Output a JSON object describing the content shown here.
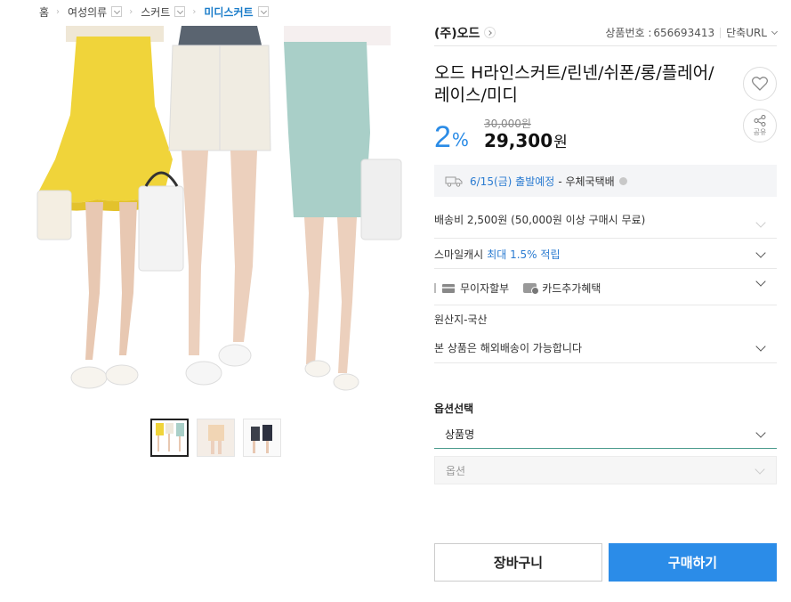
{
  "breadcrumb": {
    "items": [
      {
        "label": "홈"
      },
      {
        "label": "여성의류"
      },
      {
        "label": "스커트"
      },
      {
        "label": "미디스커트"
      }
    ]
  },
  "seller": {
    "name": "(주)오드",
    "product_no_label": "상품번호 :",
    "product_no": "656693413",
    "short_url_label": "단축URL"
  },
  "product": {
    "title": "오드 H라인스커트/린넨/쉬폰/롱/플레어/레이스/미디",
    "discount": "2",
    "discount_unit": "%",
    "original_price": "30,000원",
    "sale_price": "29,300",
    "sale_price_unit": "원"
  },
  "actions": {
    "share_label": "공유"
  },
  "shipping": {
    "date_text": "6/15(금) 출발예정",
    "method_text": "- 우체국택배",
    "fee_text": "배송비 2,500원 (50,000원 이상 구매시 무료)"
  },
  "smile_cash": {
    "label": "스마일캐시",
    "highlight": "최대 1.5% 적립"
  },
  "benefits": {
    "items": [
      {
        "label": "무이자할부",
        "icon": "card-icon"
      },
      {
        "label": "카드추가혜택",
        "icon": "card-benefit-icon"
      }
    ]
  },
  "origin_text": "원산지-국산",
  "overseas_text": "본 상품은 해외배송이 가능합니다",
  "options": {
    "title": "옵션선택",
    "product_select": "상품명",
    "option_select": "옵션"
  },
  "buttons": {
    "cart": "장바구니",
    "buy": "구매하기"
  },
  "colors": {
    "accent_blue": "#2b8ce8",
    "link_blue": "#2a7bd1",
    "active_select_border": "#4a9a8c"
  }
}
